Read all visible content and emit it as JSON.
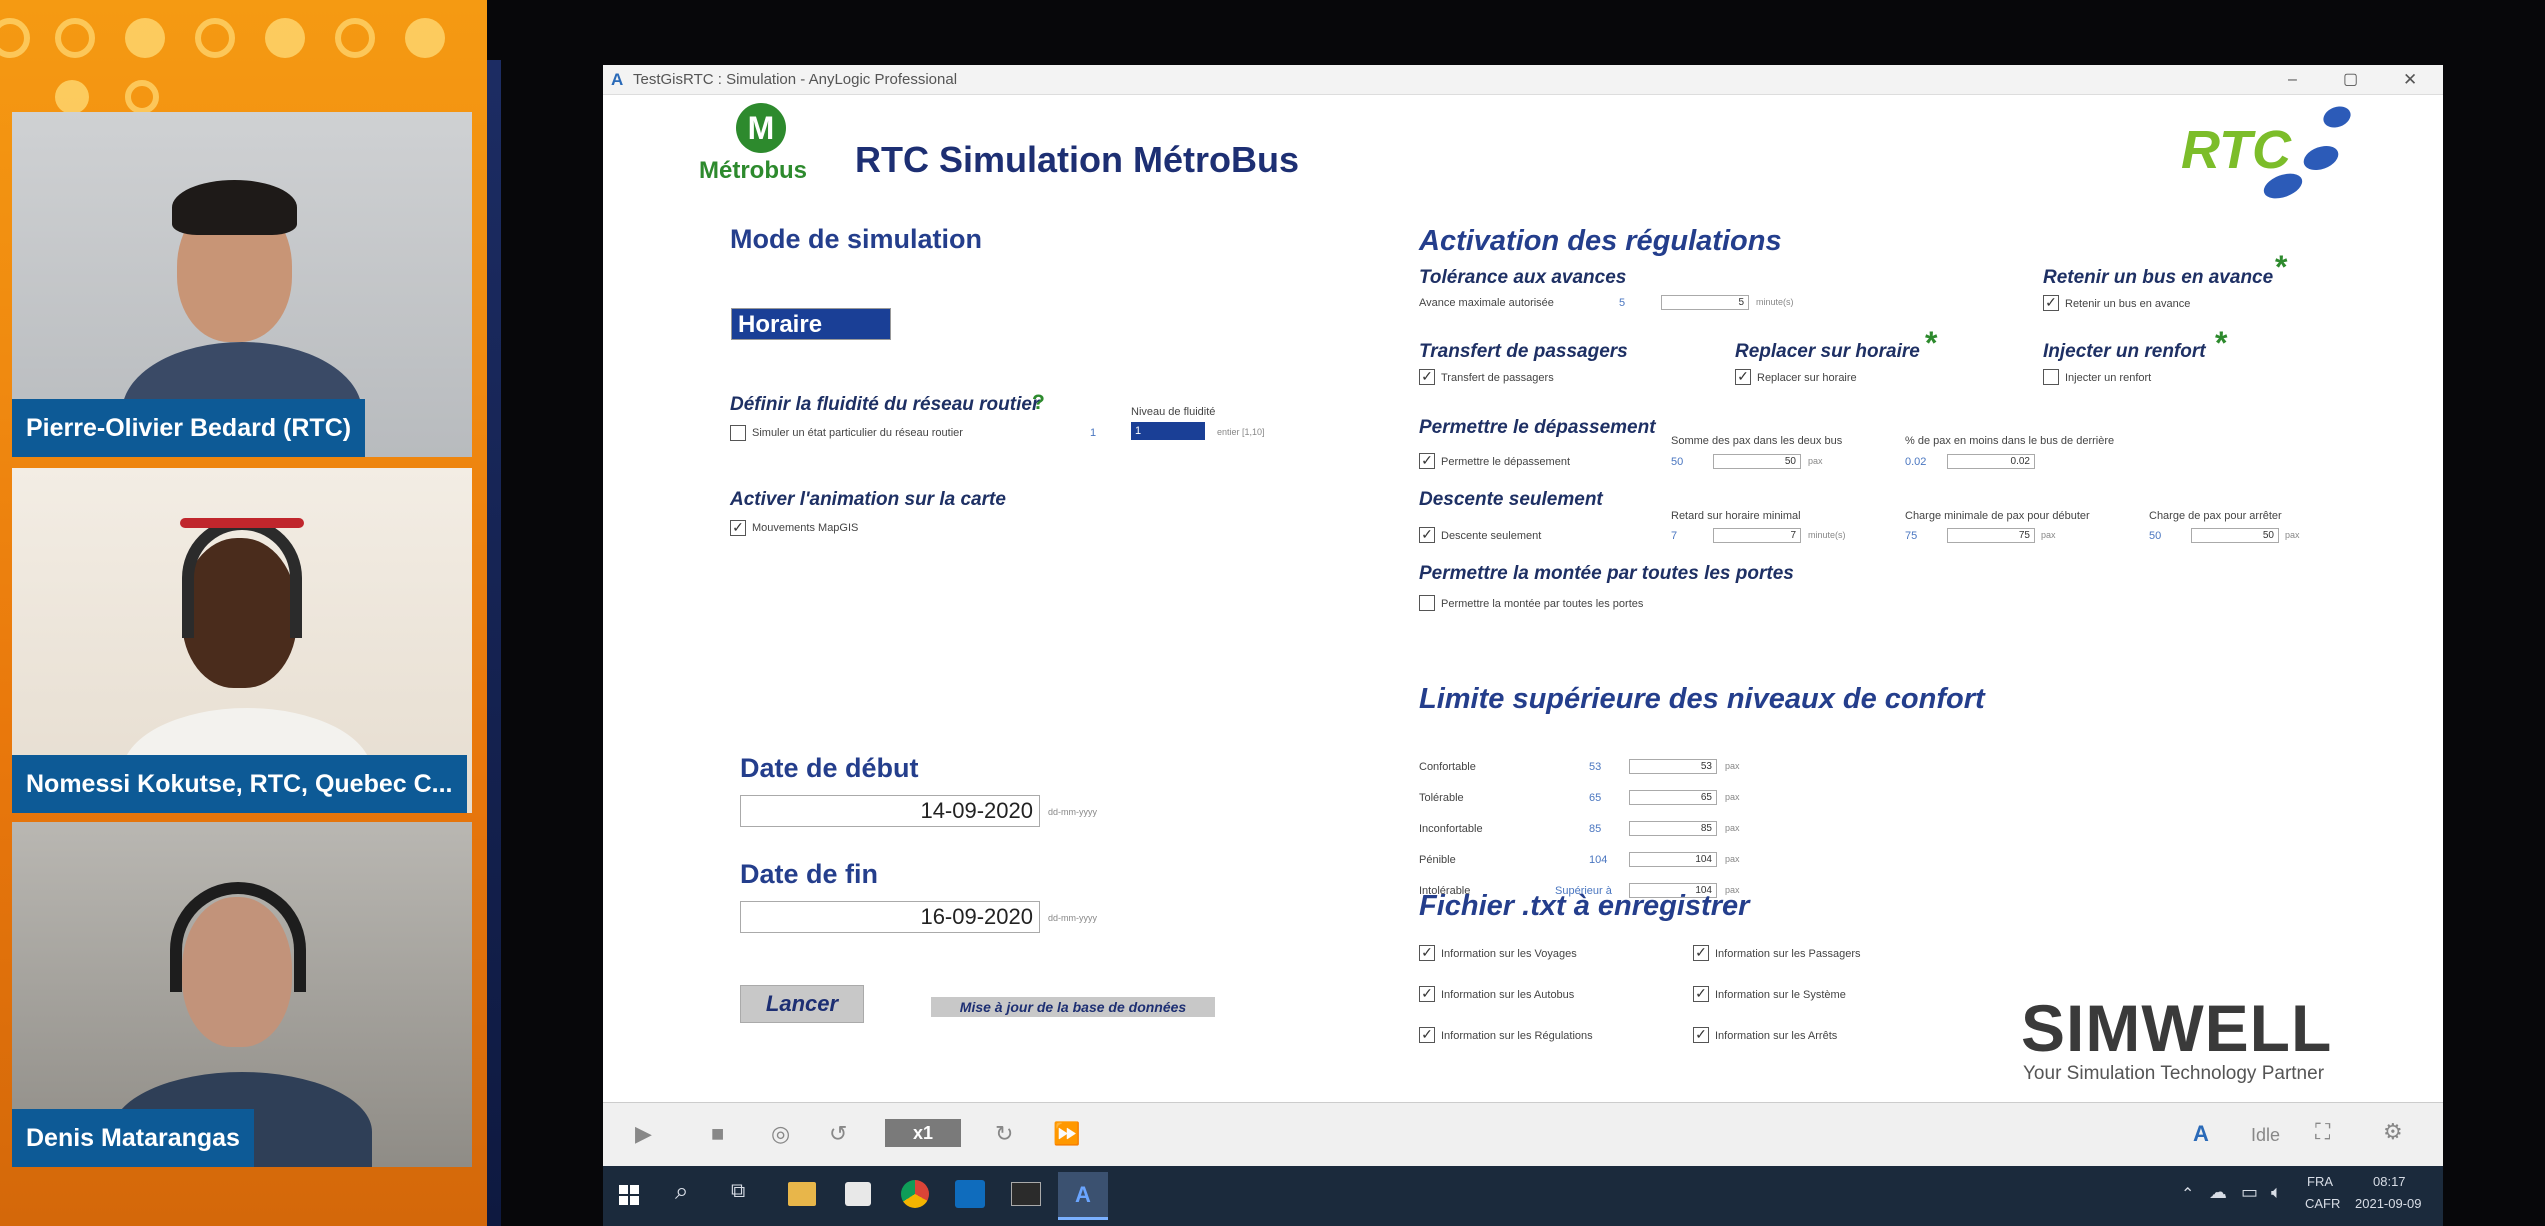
{
  "participants": [
    {
      "name": "Pierre-Olivier Bedard (RTC)"
    },
    {
      "name": "Nomessi Kokutse, RTC, Quebec C..."
    },
    {
      "name": "Denis Matarangas"
    }
  ],
  "window": {
    "title": "TestGisRTC : Simulation - AnyLogic Professional",
    "controls": {
      "minimize": "–",
      "maximize": "▢",
      "close": "✕"
    }
  },
  "header": {
    "metrobus_logo_text": "Métrobus",
    "metrobus_badge": "M",
    "title": "RTC Simulation MétroBus",
    "rtc_logo_text": "RTC"
  },
  "mode": {
    "title": "Mode de simulation",
    "value": "Horaire",
    "fluidity_title": "Définir la fluidité du réseau routier",
    "fluidity_help": "?",
    "fluidity_checkbox": "Simuler un état particulier du réseau routier",
    "fluidity_number": "1",
    "fluidity_level_label": "Niveau de fluidité",
    "fluidity_level_value": "1",
    "fluidity_level_hint": "entier [1,10]",
    "animation_title": "Activer l'animation sur la carte",
    "animation_checkbox": "Mouvements MapGIS"
  },
  "dates": {
    "start_label": "Date de début",
    "start_value": "14-09-2020",
    "end_label": "Date de fin",
    "end_value": "16-09-2020",
    "format_hint": "dd-mm-yyyy"
  },
  "actions": {
    "launch": "Lancer",
    "update_db": "Mise à jour de la base de données"
  },
  "regulations": {
    "title": "Activation des régulations",
    "tolerance_title": "Tolérance aux avances",
    "tolerance_label": "Avance maximale autorisée",
    "tolerance_value": "5",
    "tolerance_field": "5",
    "tolerance_unit": "minute(s)",
    "retain_title": "Retenir un bus en avance",
    "retain_checkbox": "Retenir un bus en avance",
    "transfer_title": "Transfert de passagers",
    "transfer_checkbox": "Transfert de passagers",
    "replace_title": "Replacer sur horaire",
    "replace_checkbox": "Replacer sur horaire",
    "reinforce_title": "Injecter un renfort",
    "reinforce_checkbox": "Injecter un renfort",
    "overtake_title": "Permettre le dépassement",
    "overtake_checkbox": "Permettre le dépassement",
    "overtake_sum_label": "Somme des pax dans les deux bus",
    "overtake_sum_value": "50",
    "overtake_sum_field": "50",
    "overtake_pct_label": "% de pax en moins dans le bus de derrière",
    "overtake_pct_value": "0.02",
    "overtake_pct_field": "0.02",
    "pax_unit": "pax",
    "descent_title": "Descente seulement",
    "descent_checkbox": "Descente seulement",
    "descent_delay_label": "Retard sur horaire minimal",
    "descent_delay_value": "7",
    "descent_delay_field": "7",
    "descent_delay_unit": "minute(s)",
    "descent_min_label": "Charge minimale de pax pour débuter",
    "descent_min_value": "75",
    "descent_min_field": "75",
    "descent_stop_label": "Charge de pax pour arrêter",
    "descent_stop_value": "50",
    "descent_stop_field": "50",
    "alldoors_title": "Permettre la montée par toutes les portes",
    "alldoors_checkbox": "Permettre la montée par toutes les portes",
    "star": "*"
  },
  "comfort": {
    "title": "Limite supérieure des niveaux de confort",
    "rows": [
      {
        "label": "Confortable",
        "value": "53",
        "field": "53",
        "unit": "pax"
      },
      {
        "label": "Tolérable",
        "value": "65",
        "field": "65",
        "unit": "pax"
      },
      {
        "label": "Inconfortable",
        "value": "85",
        "field": "85",
        "unit": "pax"
      },
      {
        "label": "Pénible",
        "value": "104",
        "field": "104",
        "unit": "pax"
      },
      {
        "label": "Intolérable",
        "value": "Supérieur à",
        "field": "104",
        "unit": "pax"
      }
    ]
  },
  "files": {
    "title": "Fichier .txt à enregistrer",
    "left": [
      "Information sur les Voyages",
      "Information sur les Autobus",
      "Information sur les Régulations"
    ],
    "right": [
      "Information sur les Passagers",
      "Information sur le Système",
      "Information sur les Arrêts"
    ]
  },
  "branding": {
    "simwell": "SIMWELL",
    "tagline": "Your Simulation Technology Partner"
  },
  "sim_toolbar": {
    "speed": "x1",
    "status": "Idle"
  },
  "taskbar": {
    "lang_top": "FRA",
    "lang_bottom": "CAFR",
    "time": "08:17",
    "date": "2021-09-09"
  }
}
